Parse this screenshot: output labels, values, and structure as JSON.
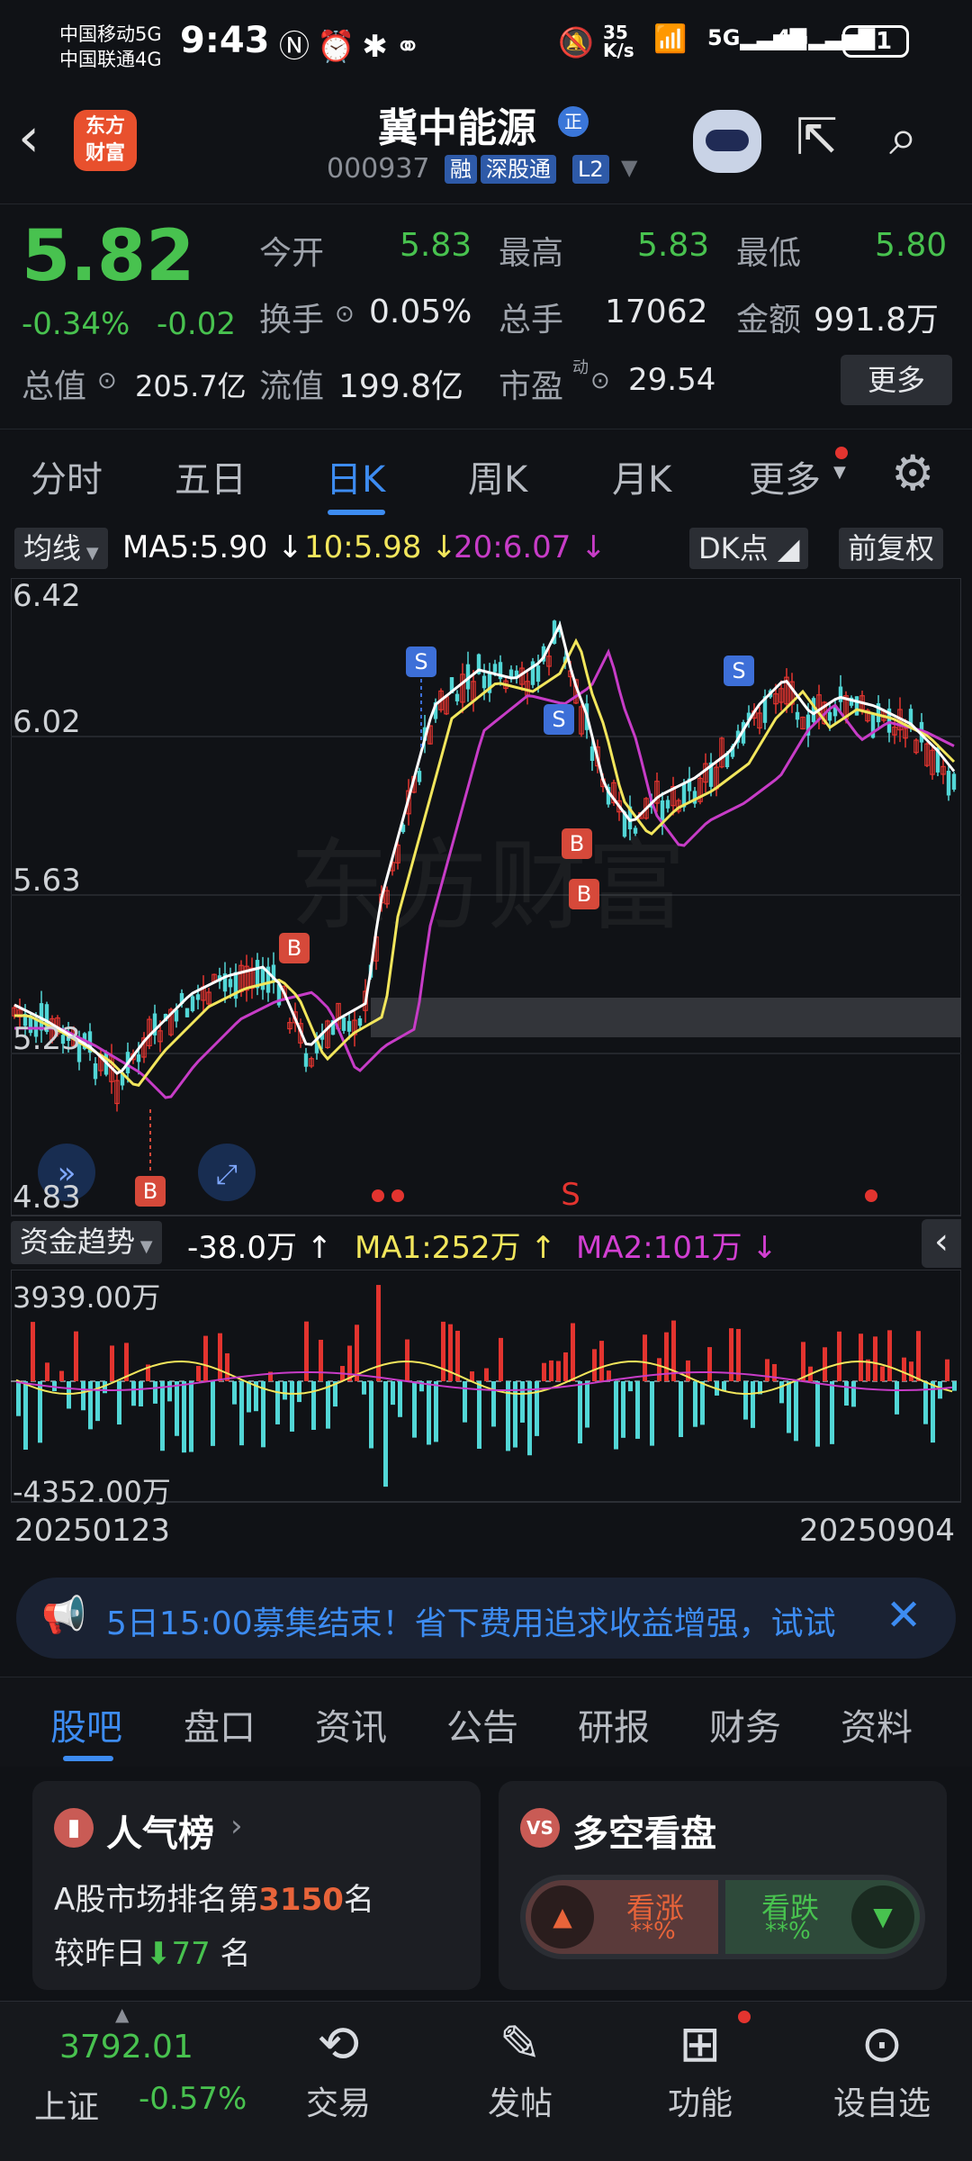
{
  "status_bar": {
    "carrier1": "中国移动5G",
    "carrier2": "中国联通4G",
    "time": "9:43",
    "net_speed": "35\nK/s",
    "battery": "51"
  },
  "header": {
    "logo_text": "东方\n财富",
    "stock_name": "冀中能源",
    "badge": "正",
    "code": "000937",
    "tags": [
      "融",
      "深股通",
      "L2"
    ]
  },
  "quote": {
    "price": "5.82",
    "change_pct": "-0.34%",
    "change_abs": "-0.02",
    "open_label": "今开",
    "open": "5.83",
    "high_label": "最高",
    "high": "5.83",
    "low_label": "最低",
    "low": "5.80",
    "turnover_label": "换手",
    "turnover": "0.05%",
    "volume_label": "总手",
    "volume": "17062",
    "amount_label": "金额",
    "amount": "991.8万",
    "mcap_label": "总值",
    "mcap": "205.7亿",
    "float_label": "流值",
    "float": "199.8亿",
    "pe_label": "市盈",
    "pe_sup": "动",
    "pe": "29.54",
    "more": "更多"
  },
  "tabs": [
    "分时",
    "五日",
    "日K",
    "周K",
    "月K",
    "更多"
  ],
  "chart": {
    "ma_btn": "均线",
    "ma5": "MA5:5.90",
    "ma10": "10:5.98",
    "ma20": "20:6.07",
    "dk_btn": "DK点",
    "fq_btn": "前复权",
    "y_labels": [
      "6.42",
      "6.02",
      "5.63",
      "5.23",
      "4.83"
    ],
    "watermark": "东方财富",
    "colors": {
      "up": "#e3342f",
      "down": "#52d6d6",
      "ma5": "#ffffff",
      "ma10": "#f2e65c",
      "ma20": "#c73cc7"
    }
  },
  "indicator": {
    "name": "资金趋势",
    "value": "-38.0万",
    "ma1": "MA1:252万",
    "ma2": "MA2:101万",
    "max": "3939.00万",
    "min": "-4352.00万"
  },
  "dates": {
    "start": "20250123",
    "end": "20250904"
  },
  "banner": {
    "text": "5日15:00募集结束！省下费用追求收益增强，试试"
  },
  "bottom_tabs": [
    "股吧",
    "盘口",
    "资讯",
    "公告",
    "研报",
    "财务",
    "资料"
  ],
  "cards": {
    "popularity": {
      "title": "人气榜",
      "rank_prefix": "A股市场排名第",
      "rank": "3150",
      "rank_suffix": "名",
      "change_prefix": "较昨日",
      "change": "77",
      "change_suffix": "名"
    },
    "bullbear": {
      "title": "多空看盘",
      "bull": "看涨",
      "bull_pct": "**%",
      "bear": "看跌",
      "bear_pct": "**%"
    }
  },
  "bottom_nav": {
    "index_value": "3792.01",
    "index_name": "上证",
    "index_change": "-0.57%",
    "items": [
      "交易",
      "发帖",
      "功能",
      "设自选"
    ]
  }
}
